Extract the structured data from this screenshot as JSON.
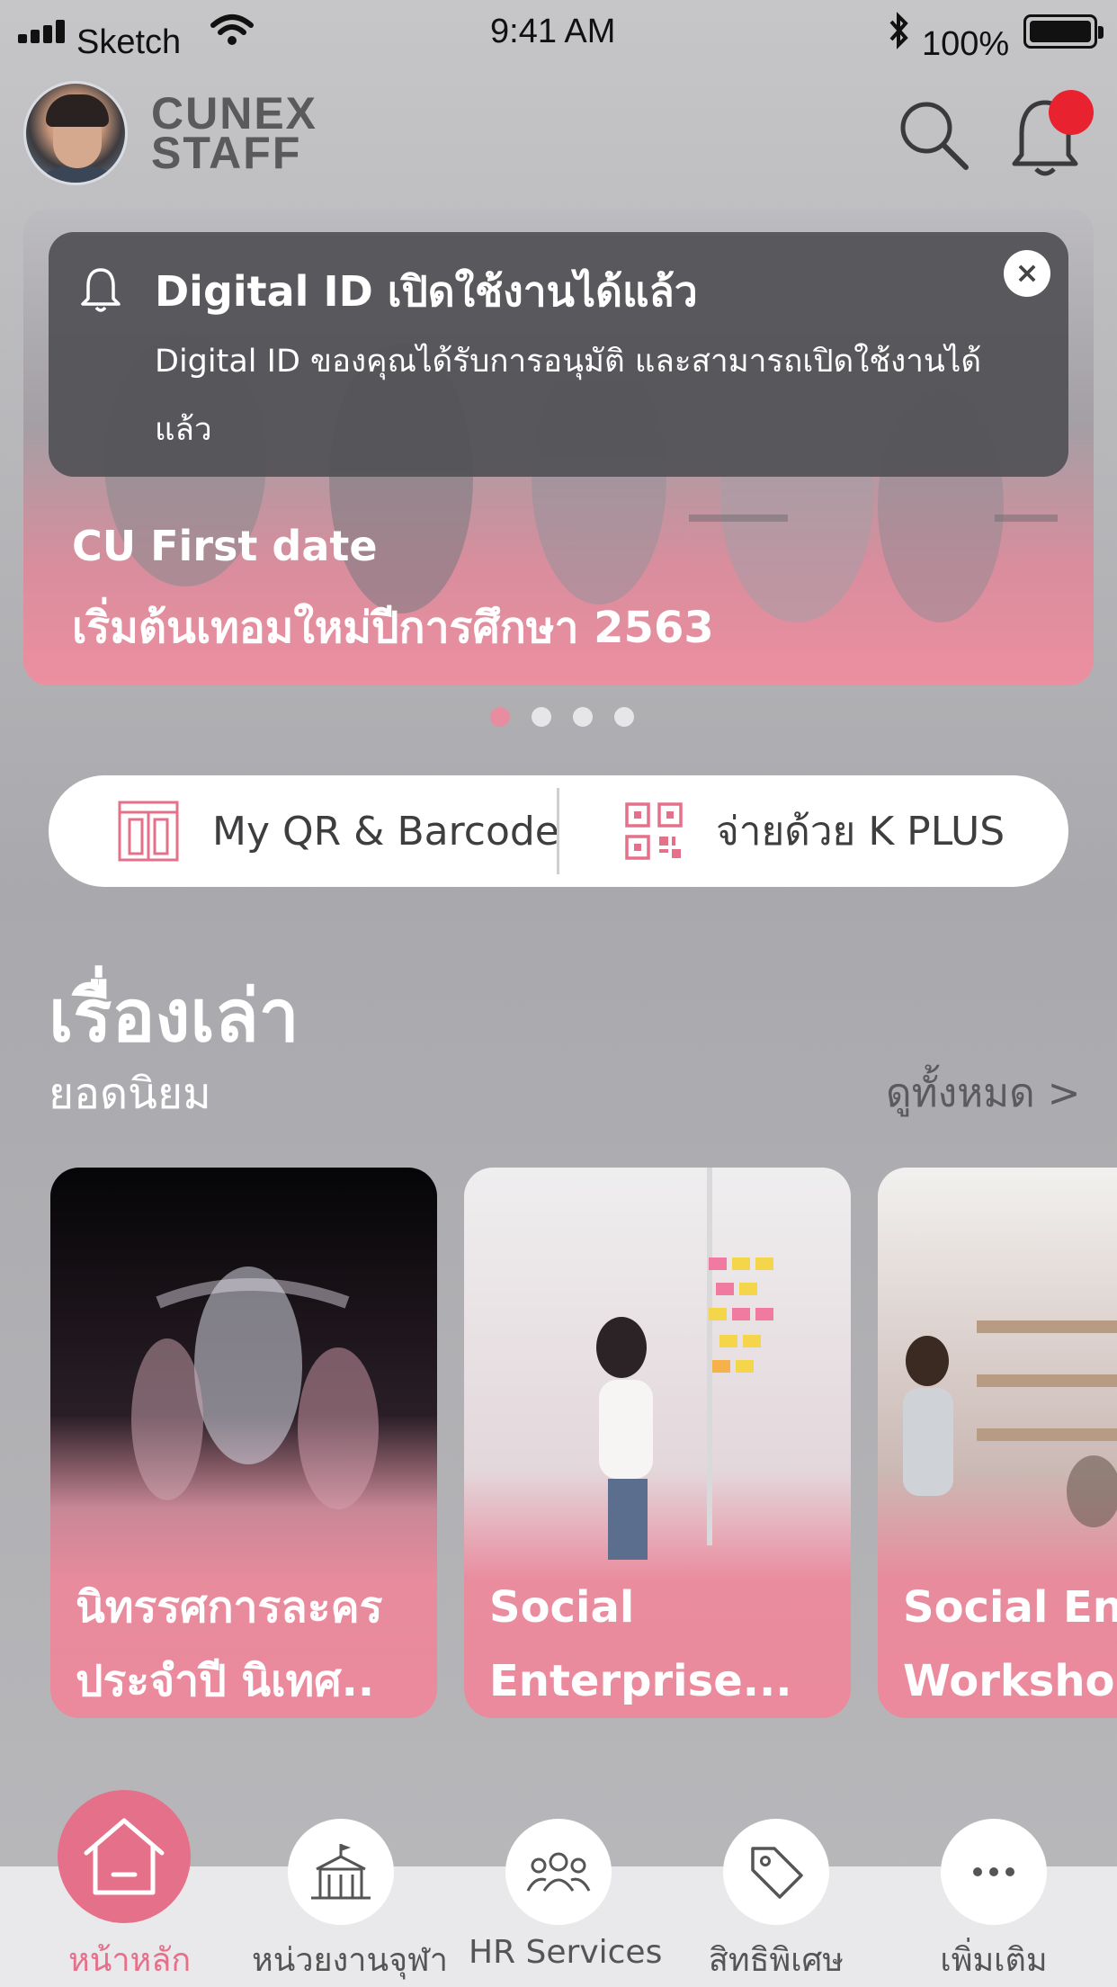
{
  "status_bar": {
    "carrier": "Sketch",
    "time": "9:41 AM",
    "battery": "100%"
  },
  "header": {
    "brand_line1": "CUNEX",
    "brand_line2": "STAFF"
  },
  "notification": {
    "title": "Digital ID เปิดใช้งานได้แล้ว",
    "body": "Digital ID ของคุณได้รับการอนุมัติ และสามารถเปิดใช้งานได้แล้ว",
    "close_label": "×"
  },
  "banner": {
    "line1": "CU First date",
    "line2": "เริ่มต้นเทอมใหม่ปีการศึกษา 2563",
    "page_count": 4,
    "active_page": 1
  },
  "quick_actions": {
    "qr": "My QR & Barcode",
    "pay": "จ่ายด้วย K PLUS"
  },
  "stories": {
    "title": "เรื่องเล่า",
    "subtitle": "ยอดนิยม",
    "see_all": "ดูทั้งหมด >",
    "cards": [
      {
        "title_line1": "นิทรรศการละคร",
        "title_line2": "ประจำปี นิเทศ.."
      },
      {
        "title_line1": "Social",
        "title_line2": "Enterprise..."
      },
      {
        "title_line1": "Social Ente",
        "title_line2": "Workshop"
      }
    ]
  },
  "bottom_nav": {
    "items": [
      {
        "label": "หน้าหลัก",
        "active": true
      },
      {
        "label": "หน่วยงานจุฬา",
        "active": false
      },
      {
        "label": "HR Services",
        "active": false
      },
      {
        "label": "สิทธิพิเศษ",
        "active": false
      },
      {
        "label": "เพิ่มเติม",
        "active": false
      }
    ]
  },
  "colors": {
    "accent": "#e5708a",
    "notification_dot": "#e8222f",
    "toast_bg": "#525256"
  }
}
